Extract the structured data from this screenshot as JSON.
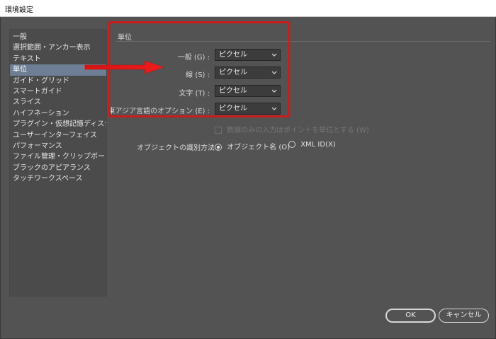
{
  "window": {
    "title": "環境設定"
  },
  "sidebar": {
    "items": [
      {
        "label": "一般"
      },
      {
        "label": "選択範囲・アンカー表示"
      },
      {
        "label": "テキスト"
      },
      {
        "label": "単位"
      },
      {
        "label": "ガイド・グリッド"
      },
      {
        "label": "スマートガイド"
      },
      {
        "label": "スライス"
      },
      {
        "label": "ハイフネーション"
      },
      {
        "label": "プラグイン・仮想記憶ディスク"
      },
      {
        "label": "ユーザーインターフェイス"
      },
      {
        "label": "パフォーマンス"
      },
      {
        "label": "ファイル管理・クリップボード"
      },
      {
        "label": "ブラックのアピアランス"
      },
      {
        "label": "タッチワークスペース"
      }
    ],
    "selected_index": 3
  },
  "units": {
    "section_title": "単位",
    "rows": [
      {
        "label": "一般 (G) :",
        "value": "ピクセル"
      },
      {
        "label": "線 (S) :",
        "value": "ピクセル"
      },
      {
        "label": "文字 (T) :",
        "value": "ピクセル"
      },
      {
        "label": "東アジア言語のオプション (E) :",
        "value": "ピクセル"
      }
    ],
    "numeric_points_checkbox": {
      "label": "数値のみの入力はポイントを単位とする (W)",
      "checked": false,
      "disabled": true
    },
    "object_id": {
      "label": "オブジェクトの識別方法 :",
      "options": [
        {
          "label": "オブジェクト名 (O)",
          "selected": true
        },
        {
          "label": "XML ID(X)",
          "selected": false
        }
      ]
    }
  },
  "buttons": {
    "ok": "OK",
    "cancel": "キャンセル"
  },
  "colors": {
    "highlight": "#cc1b1b",
    "selected_item": "#6e7f95",
    "background": "#535353"
  }
}
